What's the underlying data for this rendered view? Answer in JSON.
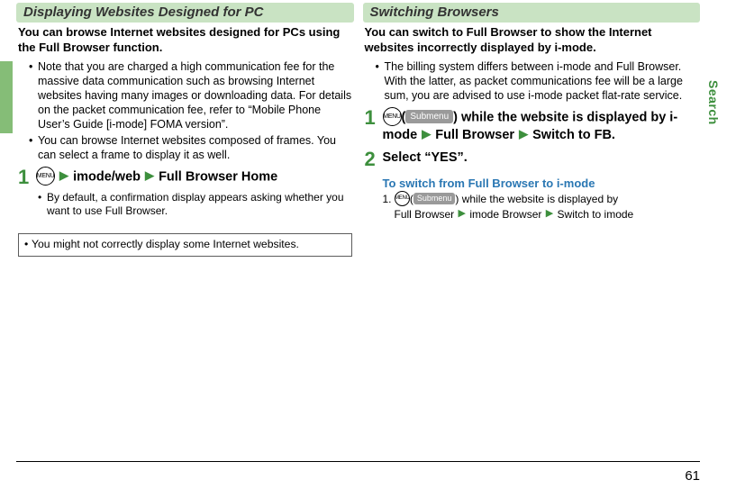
{
  "left": {
    "header": "Displaying Websites Designed for PC",
    "intro": "You can browse Internet websites designed for PCs using the Full Browser function.",
    "bullets": [
      "Note that you are charged a high communication fee for the massive data communication such as browsing Internet websites having many images or downloading data. For details on the packet communication fee, refer to “Mobile Phone User’s Guide [i-mode] FOMA version”.",
      "You can browse Internet websites composed of frames. You can select a frame to display it as well."
    ],
    "step1": {
      "num": "1",
      "menu_label": "MENU",
      "part1": "imode/web",
      "part2": "Full Browser Home",
      "sub": "By default, a confirmation display appears asking whether you want to use Full Browser."
    },
    "note": "You might not correctly display some Internet websites."
  },
  "right": {
    "header": "Switching Browsers",
    "intro": "You can switch to Full Browser to show the Internet websites incorrectly displayed by i-mode.",
    "bullets": [
      "The billing system differs between i-mode and Full Browser. With the latter, as packet communications fee will be a large sum, you are advised to use i-mode packet flat-rate service."
    ],
    "step1": {
      "num": "1",
      "menu_label": "MENU",
      "submenu_label": "Submenu",
      "paren_open": "(",
      "paren_close": ")",
      "tail1": " while the website is displayed by i-mode",
      "part2": "Full Browser",
      "part3": "Switch to FB."
    },
    "step2": {
      "num": "2",
      "text": "Select “YES”."
    },
    "subhead": "To switch from Full Browser to i-mode",
    "substep": {
      "prefix": "1. ",
      "menu_label": "MENU",
      "submenu_label": "Submenu",
      "paren_open": "(",
      "paren_close": ")",
      "tail1": " while the website is displayed by",
      "line2a": "Full Browser",
      "line2b": "imode Browser",
      "line2c": "Switch to imode"
    }
  },
  "side_label": "Search",
  "page_number": "61"
}
